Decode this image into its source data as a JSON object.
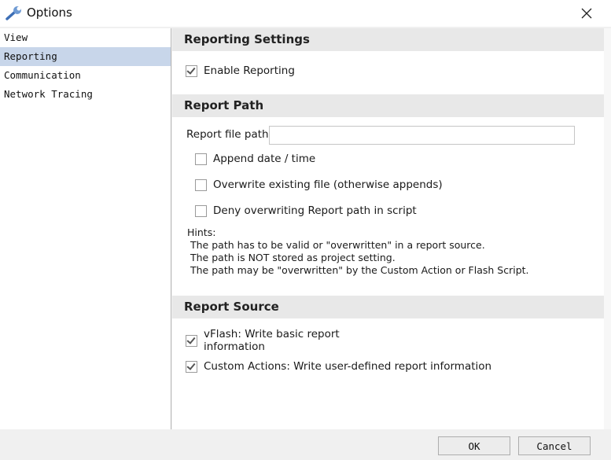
{
  "window": {
    "title": "Options",
    "icon": "wrench-icon"
  },
  "sidebar": {
    "items": [
      {
        "label": "View",
        "selected": false
      },
      {
        "label": "Reporting",
        "selected": true
      },
      {
        "label": "Communication",
        "selected": false
      },
      {
        "label": "Network Tracing",
        "selected": false
      }
    ]
  },
  "sections": {
    "reporting_settings": {
      "title": "Reporting Settings",
      "enable_reporting": {
        "label": "Enable Reporting",
        "checked": true
      }
    },
    "report_path": {
      "title": "Report Path",
      "file_path_label": "Report file path:",
      "file_path_value": "",
      "options": [
        {
          "label": "Append date / time",
          "checked": false
        },
        {
          "label": "Overwrite existing file (otherwise appends)",
          "checked": false
        },
        {
          "label": "Deny overwriting Report path in script",
          "checked": false
        }
      ],
      "hints": {
        "title": "Hints:",
        "lines": [
          "The path has to be valid or \"overwritten\" in a report source.",
          "The path is NOT stored as project setting.",
          "The path may be \"overwritten\" by the Custom Action or Flash Script."
        ]
      }
    },
    "report_source": {
      "title": "Report Source",
      "options": [
        {
          "label": "vFlash: Write basic report information",
          "checked": true
        },
        {
          "label": "Custom Actions: Write user-defined report information",
          "checked": true
        }
      ]
    }
  },
  "footer": {
    "ok_label": "OK",
    "cancel_label": "Cancel"
  },
  "colors": {
    "selected_item": "#c8d6ea",
    "section_header": "#e8e8e8"
  }
}
